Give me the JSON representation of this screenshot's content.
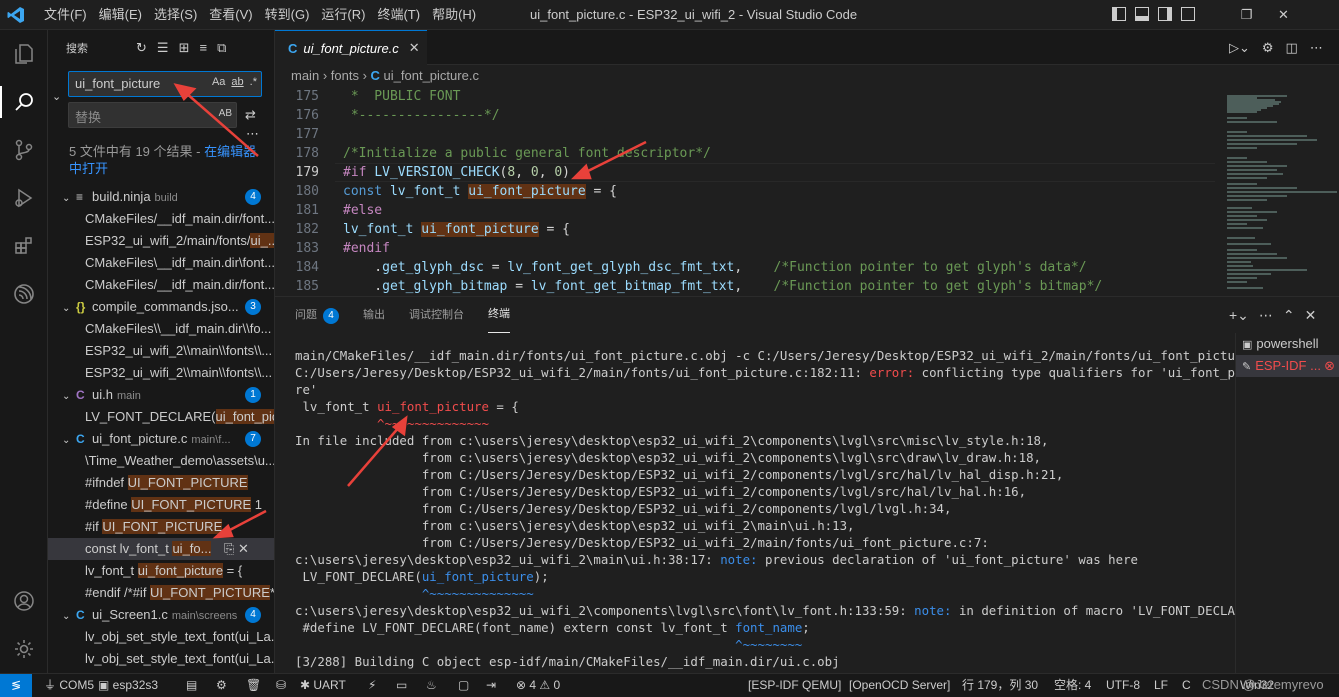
{
  "titlebar": {
    "menus": [
      "文件(F)",
      "编辑(E)",
      "选择(S)",
      "查看(V)",
      "转到(G)",
      "运行(R)",
      "终端(T)",
      "帮助(H)"
    ],
    "title": "ui_font_picture.c - ESP32_ui_wifi_2 - Visual Studio Code"
  },
  "sidebar": {
    "title": "搜索",
    "search_value": "ui_font_picture",
    "search_opts": [
      "Aa",
      "ab",
      ".*"
    ],
    "replace_placeholder": "替换",
    "replace_opt": "AB",
    "result_text": "5 文件中有 19 个结果 - ",
    "result_link": "在编辑器中打开",
    "results": [
      {
        "type": "file",
        "icon": "≡",
        "icon_color": "#cccccc",
        "name": "build.ninja",
        "dir": "build",
        "count": "4"
      },
      {
        "type": "match",
        "pre": "CMakeFiles/__idf_main.dir/font...",
        "hl": "",
        "post": ""
      },
      {
        "type": "match",
        "pre": "ESP32_ui_wifi_2/main/fonts/",
        "hl": "ui_...",
        "post": ""
      },
      {
        "type": "match",
        "pre": "CMakeFiles\\__idf_main.dir\\font...",
        "hl": "",
        "post": ""
      },
      {
        "type": "match",
        "pre": "CMakeFiles/__idf_main.dir/font...",
        "hl": "",
        "post": ""
      },
      {
        "type": "file",
        "icon": "{}",
        "icon_color": "#cbcb41",
        "name": "compile_commands.jso...",
        "dir": "",
        "count": "3"
      },
      {
        "type": "match",
        "pre": "CMakeFiles\\\\__idf_main.dir\\\\fo...",
        "hl": "",
        "post": ""
      },
      {
        "type": "match",
        "pre": "ESP32_ui_wifi_2\\\\main\\\\fonts\\\\...",
        "hl": "",
        "post": ""
      },
      {
        "type": "match",
        "pre": "ESP32_ui_wifi_2\\\\main\\\\fonts\\\\...",
        "hl": "",
        "post": ""
      },
      {
        "type": "file",
        "icon": "C",
        "icon_color": "#a074c4",
        "name": "ui.h",
        "dir": "main",
        "count": "1"
      },
      {
        "type": "match",
        "pre": "LV_FONT_DECLARE(",
        "hl": "ui_font_pic...",
        "post": ""
      },
      {
        "type": "file",
        "icon": "C",
        "icon_color": "#3ca6f0",
        "name": "ui_font_picture.c",
        "dir": "main\\f...",
        "count": "7"
      },
      {
        "type": "match",
        "pre": "\\Time_Weather_demo\\assets\\u...",
        "hl": "",
        "post": ""
      },
      {
        "type": "match",
        "pre": "#ifndef ",
        "hl": "UI_FONT_PICTURE",
        "post": ""
      },
      {
        "type": "match",
        "pre": "#define ",
        "hl": "UI_FONT_PICTURE",
        "post": " 1"
      },
      {
        "type": "match",
        "pre": "#if ",
        "hl": "UI_FONT_PICTURE",
        "post": ""
      },
      {
        "type": "match",
        "pre": "const lv_font_t ",
        "hl": "ui_fo...",
        "post": "",
        "selected": true
      },
      {
        "type": "match",
        "pre": "lv_font_t ",
        "hl": "ui_font_picture",
        "post": " = {"
      },
      {
        "type": "match",
        "pre": "#endif /*#if ",
        "hl": "UI_FONT_PICTURE",
        "post": "*/"
      },
      {
        "type": "file",
        "icon": "C",
        "icon_color": "#3ca6f0",
        "name": "ui_Screen1.c",
        "dir": "main\\screens",
        "count": "4"
      },
      {
        "type": "match",
        "pre": "lv_obj_set_style_text_font(ui_La...",
        "hl": "",
        "post": ""
      },
      {
        "type": "match",
        "pre": "lv_obj_set_style_text_font(ui_La...",
        "hl": "",
        "post": ""
      }
    ]
  },
  "tab": {
    "label": "ui_font_picture.c"
  },
  "breadcrumb": [
    "main",
    "fonts",
    "ui_font_picture.c"
  ],
  "editor": {
    "current_line": 179,
    "lines": [
      {
        "n": "175",
        "segs": [
          [
            "k-com",
            " *  PUBLIC FONT"
          ]
        ]
      },
      {
        "n": "176",
        "segs": [
          [
            "k-com",
            " *----------------*/"
          ]
        ]
      },
      {
        "n": "177",
        "segs": []
      },
      {
        "n": "178",
        "segs": [
          [
            "k-com",
            "/*Initialize a public general font descriptor*/"
          ]
        ]
      },
      {
        "n": "179",
        "segs": [
          [
            "k-pp",
            "#if "
          ],
          [
            "k-var",
            "LV_VERSION_CHECK"
          ],
          [
            "k-white",
            "("
          ],
          [
            "k-num",
            "8"
          ],
          [
            "k-white",
            ", "
          ],
          [
            "k-num",
            "0"
          ],
          [
            "k-white",
            ", "
          ],
          [
            "k-num",
            "0"
          ],
          [
            "k-white",
            ")"
          ]
        ]
      },
      {
        "n": "180",
        "segs": [
          [
            "k-type",
            "const "
          ],
          [
            "k-var",
            "lv_font_t "
          ],
          [
            "k-hlvar",
            "ui_font_picture"
          ],
          [
            "k-white",
            " = {"
          ]
        ]
      },
      {
        "n": "181",
        "segs": [
          [
            "k-pp",
            "#else"
          ]
        ]
      },
      {
        "n": "182",
        "segs": [
          [
            "k-var",
            "lv_font_t "
          ],
          [
            "k-hlvar",
            "ui_font_picture"
          ],
          [
            "k-white",
            " = {"
          ]
        ]
      },
      {
        "n": "183",
        "segs": [
          [
            "k-pp",
            "#endif"
          ]
        ]
      },
      {
        "n": "184",
        "segs": [
          [
            "k-white",
            "    ."
          ],
          [
            "k-var",
            "get_glyph_dsc"
          ],
          [
            "k-white",
            " = "
          ],
          [
            "k-var",
            "lv_font_get_glyph_dsc_fmt_txt"
          ],
          [
            "k-white",
            ",    "
          ],
          [
            "k-com",
            "/*Function pointer to get glyph's data*/"
          ]
        ]
      },
      {
        "n": "185",
        "segs": [
          [
            "k-white",
            "    ."
          ],
          [
            "k-var",
            "get_glyph_bitmap"
          ],
          [
            "k-white",
            " = "
          ],
          [
            "k-var",
            "lv_font_get_bitmap_fmt_txt"
          ],
          [
            "k-white",
            ",    "
          ],
          [
            "k-com",
            "/*Function pointer to get glyph's bitmap*/"
          ]
        ]
      }
    ]
  },
  "panel": {
    "tabs": [
      "问题",
      "输出",
      "调试控制台",
      "终端"
    ],
    "problems_count": "4",
    "terminal_lines": [
      [
        [
          "",
          "main/CMakeFiles/__idf_main.dir/fonts/ui_font_picture.c.obj -c C:/Users/Jeresy/Desktop/ESP32_ui_wifi_2/main/fonts/ui_font_picture.c"
        ]
      ],
      [
        [
          "b",
          "C:/Users/Jeresy/Desktop/ESP32_ui_wifi_2/main/fonts/ui_font_picture.c:182:11: "
        ],
        [
          "b t-err",
          "error: "
        ],
        [
          "",
          "conflicting type qualifiers for "
        ],
        [
          "b",
          "'ui_font_pictu"
        ]
      ],
      [
        [
          "b",
          "re'"
        ]
      ],
      [
        [
          "",
          " lv_font_t "
        ],
        [
          "t-red",
          "ui_font_picture"
        ],
        [
          "",
          " = {"
        ]
      ],
      [
        [
          "t-tilde-r",
          "           ^~~~~~~~~~~~~~~"
        ]
      ],
      [
        [
          "",
          "In file included from "
        ],
        [
          "b",
          "c:\\users\\jeresy\\desktop\\esp32_ui_wifi_2\\components\\lvgl\\src\\misc\\lv_style.h:18"
        ],
        [
          "",
          ","
        ]
      ],
      [
        [
          "",
          "                 from "
        ],
        [
          "b",
          "c:\\users\\jeresy\\desktop\\esp32_ui_wifi_2\\components\\lvgl\\src\\draw\\lv_draw.h:18"
        ],
        [
          "",
          ","
        ]
      ],
      [
        [
          "",
          "                 from "
        ],
        [
          "b",
          "C:/Users/Jeresy/Desktop/ESP32_ui_wifi_2/components/lvgl/src/hal/lv_hal_disp.h:21"
        ],
        [
          "",
          ","
        ]
      ],
      [
        [
          "",
          "                 from "
        ],
        [
          "b",
          "C:/Users/Jeresy/Desktop/ESP32_ui_wifi_2/components/lvgl/src/hal/lv_hal.h:16"
        ],
        [
          "",
          ","
        ]
      ],
      [
        [
          "",
          "                 from "
        ],
        [
          "b",
          "C:/Users/Jeresy/Desktop/ESP32_ui_wifi_2/components/lvgl/lvgl.h:34"
        ],
        [
          "",
          ","
        ]
      ],
      [
        [
          "",
          "                 from "
        ],
        [
          "b",
          "c:\\users\\jeresy\\desktop\\esp32_ui_wifi_2\\main\\ui.h:13"
        ],
        [
          "",
          ","
        ]
      ],
      [
        [
          "",
          "                 from "
        ],
        [
          "b",
          "C:/Users/Jeresy/Desktop/ESP32_ui_wifi_2/main/fonts/ui_font_picture.c:7"
        ],
        [
          "",
          ":"
        ]
      ],
      [
        [
          "b",
          "c:\\users\\jeresy\\desktop\\esp32_ui_wifi_2\\main\\ui.h:38:17: "
        ],
        [
          "b t-note",
          "note: "
        ],
        [
          "",
          "previous declaration of "
        ],
        [
          "b",
          "'ui_font_picture'"
        ],
        [
          "",
          " was here"
        ]
      ],
      [
        [
          "",
          " LV_FONT_DECLARE("
        ],
        [
          "t-blue",
          "ui_font_picture"
        ],
        [
          "",
          ");"
        ]
      ],
      [
        [
          "t-tilde-b",
          "                 ^~~~~~~~~~~~~~~"
        ]
      ],
      [
        [
          "b",
          "c:\\users\\jeresy\\desktop\\esp32_ui_wifi_2\\components\\lvgl\\src\\font\\lv_font.h:133:59: "
        ],
        [
          "b t-note",
          "note: "
        ],
        [
          "",
          "in definition of macro "
        ],
        [
          "b",
          "'LV_FONT_DECLARE'"
        ]
      ],
      [
        [
          "",
          " #define LV_FONT_DECLARE(font_name) extern const lv_font_t "
        ],
        [
          "t-blue",
          "font_name"
        ],
        [
          "",
          ";"
        ]
      ],
      [
        [
          "t-tilde-b",
          "                                                           ^~~~~~~~~"
        ]
      ],
      [
        [
          "",
          "[3/288] Building C object esp-idf/main/CMakeFiles/__idf_main.dir/ui.c.obj"
        ]
      ]
    ],
    "terminals": [
      {
        "name": "powershell",
        "icon": "▣"
      },
      {
        "name": "ESP-IDF ...",
        "icon": "✎",
        "selected": true
      }
    ]
  },
  "statusbar": {
    "com": "COM5",
    "target": "esp32s3",
    "uart": "UART",
    "problems": "⊗ 4 ⚠ 0",
    "qemu": "[ESP-IDF QEMU]",
    "openocd": "[OpenOCD Server]",
    "cursor": "行 179，列 30",
    "spaces": "空格: 4",
    "encoding": "UTF-8",
    "eol": "LF",
    "lang": "C",
    "platform": "Win32",
    "watermark": "CSDN @Jeremyrevo"
  },
  "colors": {
    "accent": "#0078d4",
    "match_highlight": "#613214",
    "annotation_arrow": "#e8413a"
  }
}
